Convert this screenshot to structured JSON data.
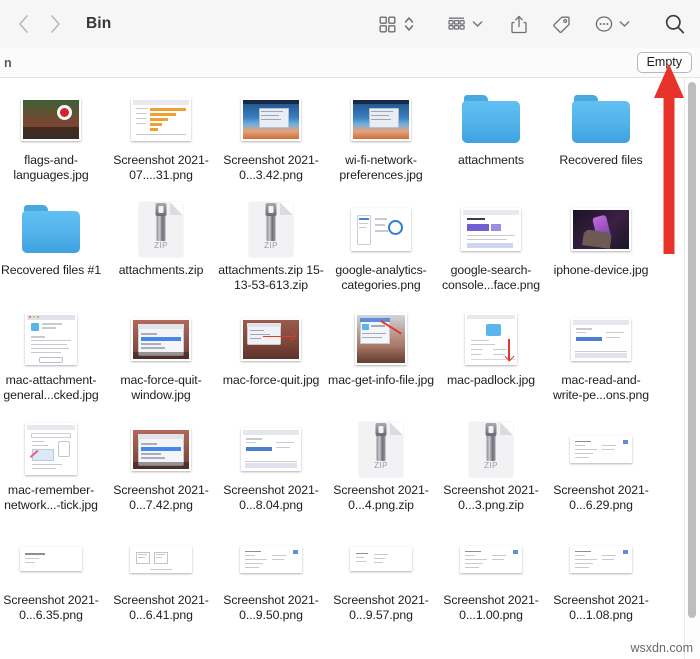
{
  "window": {
    "title": "Bin"
  },
  "toolbar": {
    "back_label": "Back",
    "forward_label": "Forward",
    "icon_view_label": "Icon view",
    "sort_label": "Sort order",
    "group_label": "Group items",
    "share_label": "Share",
    "tag_label": "Tags",
    "more_label": "More options",
    "search_label": "Search"
  },
  "subbar": {
    "text": "n",
    "empty_button": "Empty"
  },
  "annotation": {
    "arrow_color": "#e8332a",
    "arrow_target": "Empty"
  },
  "colors": {
    "folder_blue": "#51b2ea",
    "toolbar_bg": "#f6f6f6",
    "accent_red": "#e8332a"
  },
  "watermark": "wsxdn.com",
  "files": [
    {
      "name": "flags-and-languages.jpg",
      "kind": "photo",
      "thumb": "flag-photo"
    },
    {
      "name": "Screenshot 2021-07....31.png",
      "kind": "screenshot",
      "thumb": "chart-doc"
    },
    {
      "name": "Screenshot 2021-0...3.42.png",
      "kind": "screenshot",
      "thumb": "desktop-shot"
    },
    {
      "name": "wi-fi-network-preferences.jpg",
      "kind": "photo",
      "thumb": "desktop-shot"
    },
    {
      "name": "attachments",
      "kind": "folder",
      "thumb": "folder"
    },
    {
      "name": "Recovered files",
      "kind": "folder",
      "thumb": "folder"
    },
    {
      "name": "Recovered files #1",
      "kind": "folder",
      "thumb": "folder"
    },
    {
      "name": "attachments.zip",
      "kind": "zip",
      "thumb": "zip"
    },
    {
      "name": "attachments.zip 15-13-53-613.zip",
      "kind": "zip",
      "thumb": "zip"
    },
    {
      "name": "google-analytics-categories.png",
      "kind": "screenshot",
      "thumb": "analytics-doc"
    },
    {
      "name": "google-search-console...face.png",
      "kind": "screenshot",
      "thumb": "console-doc"
    },
    {
      "name": "iphone-device.jpg",
      "kind": "photo",
      "thumb": "iphone-photo"
    },
    {
      "name": "mac-attachment-general...cked.jpg",
      "kind": "photo",
      "thumb": "mac-info-shot"
    },
    {
      "name": "mac-force-quit-window.jpg",
      "kind": "photo",
      "thumb": "mac-quit-shot"
    },
    {
      "name": "mac-force-quit.jpg",
      "kind": "photo",
      "thumb": "mac-street-shot"
    },
    {
      "name": "mac-get-info-file.jpg",
      "kind": "photo",
      "thumb": "mac-getinfo-shot"
    },
    {
      "name": "mac-padlock.jpg",
      "kind": "photo",
      "thumb": "mac-padlock-shot"
    },
    {
      "name": "mac-read-and-write-pe...ons.png",
      "kind": "screenshot",
      "thumb": "mac-perm-shot"
    },
    {
      "name": "mac-remember-network...-tick.jpg",
      "kind": "photo",
      "thumb": "mac-network-shot"
    },
    {
      "name": "Screenshot 2021-0...7.42.png",
      "kind": "screenshot",
      "thumb": "mac-quit-shot"
    },
    {
      "name": "Screenshot 2021-0...8.04.png",
      "kind": "screenshot",
      "thumb": "mac-perm-shot"
    },
    {
      "name": "Screenshot 2021-0...4.png.zip",
      "kind": "zip",
      "thumb": "zip"
    },
    {
      "name": "Screenshot 2021-0...3.png.zip",
      "kind": "zip",
      "thumb": "zip"
    },
    {
      "name": "Screenshot 2021-0...6.29.png",
      "kind": "screenshot",
      "thumb": "win-doc"
    },
    {
      "name": "Screenshot 2021-0...6.35.png",
      "kind": "screenshot",
      "thumb": "thin-doc"
    },
    {
      "name": "Screenshot 2021-0...6.41.png",
      "kind": "screenshot",
      "thumb": "two-col-doc"
    },
    {
      "name": "Screenshot 2021-0...9.50.png",
      "kind": "screenshot",
      "thumb": "win-doc"
    },
    {
      "name": "Screenshot 2021-0...9.57.png",
      "kind": "screenshot",
      "thumb": "text-doc"
    },
    {
      "name": "Screenshot 2021-0...1.00.png",
      "kind": "screenshot",
      "thumb": "win-doc"
    },
    {
      "name": "Screenshot 2021-0...1.08.png",
      "kind": "screenshot",
      "thumb": "win-doc"
    }
  ]
}
